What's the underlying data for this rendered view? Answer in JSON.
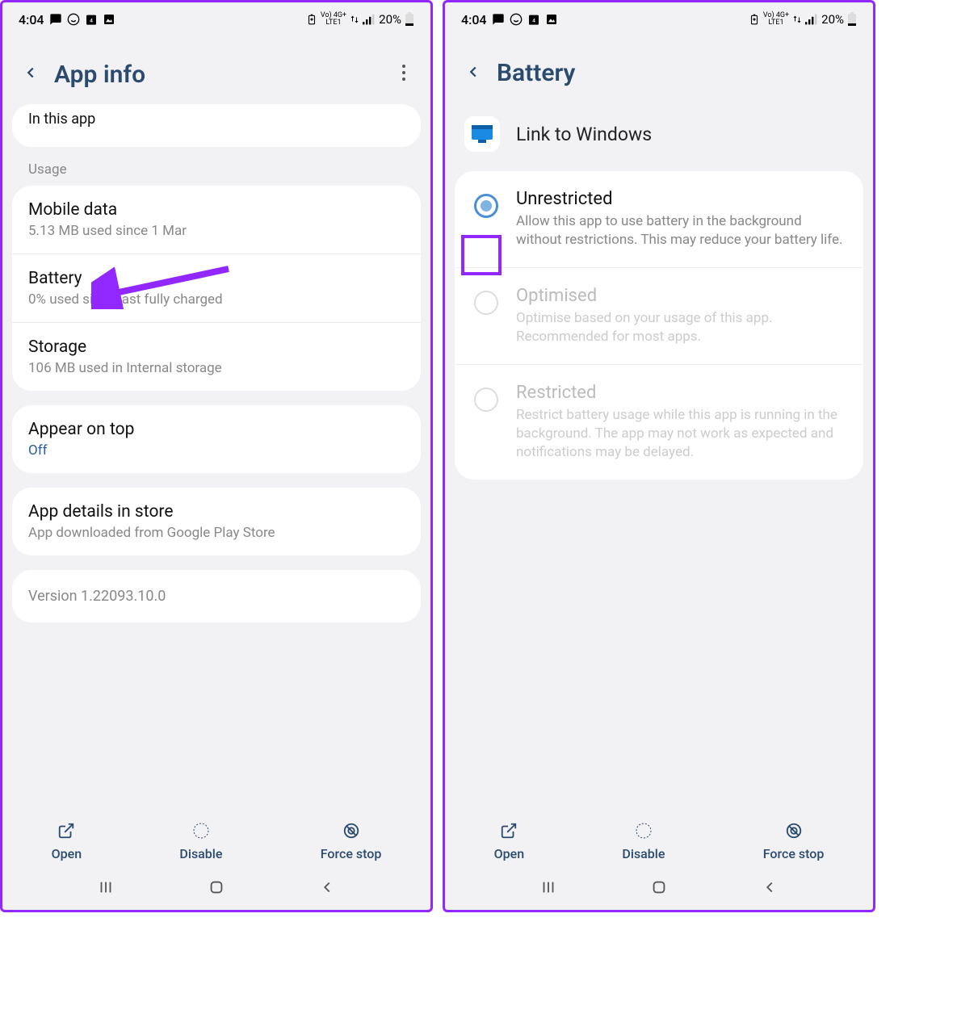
{
  "status": {
    "time": "4:04",
    "battery_pct": "20%",
    "network_badge": "Vo) 4G+",
    "lte": "LTE1"
  },
  "left": {
    "header_title": "App info",
    "truncated_row": "In this app",
    "section_usage": "Usage",
    "items": [
      {
        "title": "Mobile data",
        "sub": "5.13 MB used since 1 Mar"
      },
      {
        "title": "Battery",
        "sub": "0% used since last fully charged"
      },
      {
        "title": "Storage",
        "sub": "106 MB used in Internal storage"
      }
    ],
    "appear": {
      "title": "Appear on top",
      "value": "Off"
    },
    "store": {
      "title": "App details in store",
      "sub": "App downloaded from Google Play Store"
    },
    "version": "Version 1.22093.10.0"
  },
  "right": {
    "header_title": "Battery",
    "app_name": "Link to Windows",
    "options": [
      {
        "title": "Unrestricted",
        "desc": "Allow this app to use battery in the background without restrictions. This may reduce your battery life.",
        "selected": true,
        "dim": false
      },
      {
        "title": "Optimised",
        "desc": "Optimise based on your usage of this app. Recommended for most apps.",
        "selected": false,
        "dim": true
      },
      {
        "title": "Restricted",
        "desc": "Restrict battery usage while this app is running in the background. The app may not work as expected and notifications may be delayed.",
        "selected": false,
        "dim": true
      }
    ]
  },
  "actions": {
    "open": "Open",
    "disable": "Disable",
    "force_stop": "Force stop"
  }
}
